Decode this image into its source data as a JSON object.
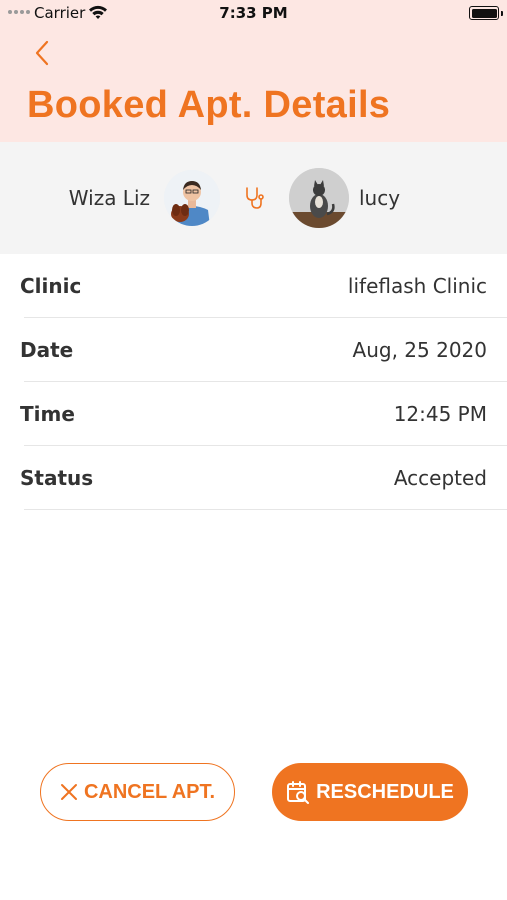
{
  "status_bar": {
    "carrier": "Carrier",
    "time": "7:33 PM"
  },
  "header": {
    "title": "Booked Apt. Details"
  },
  "participants": {
    "vet_name": "Wiza Liz",
    "pet_name": "lucy"
  },
  "details": [
    {
      "label": "Clinic",
      "value": "lifeflash Clinic"
    },
    {
      "label": "Date",
      "value": "Aug, 25 2020"
    },
    {
      "label": "Time",
      "value": "12:45 PM"
    },
    {
      "label": "Status",
      "value": "Accepted"
    }
  ],
  "actions": {
    "cancel_label": "CANCEL APT.",
    "reschedule_label": "RESCHEDULE"
  },
  "colors": {
    "accent": "#ef7421",
    "header_bg": "#fde7e3"
  }
}
